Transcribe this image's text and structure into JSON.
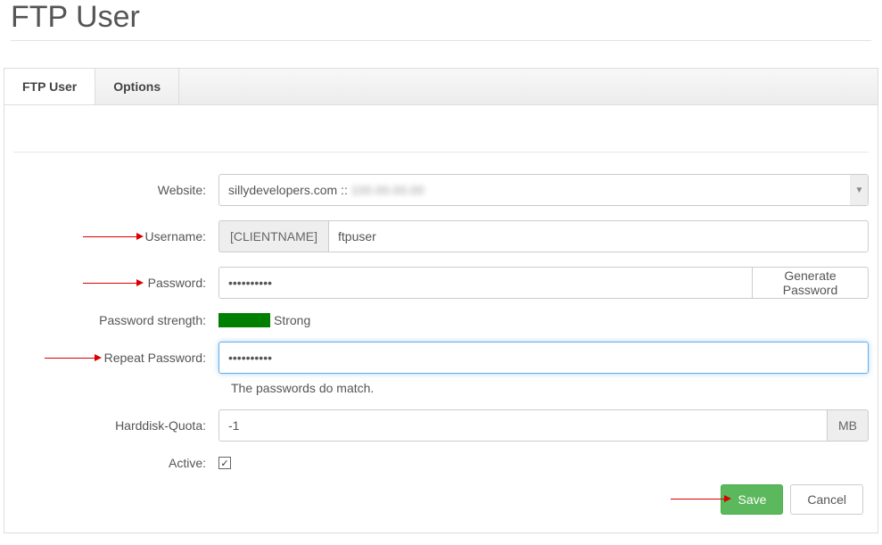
{
  "header": {
    "title": "FTP User"
  },
  "tabs": {
    "active": "FTP User",
    "other": "Options"
  },
  "form": {
    "website": {
      "label": "Website:",
      "value": "sillydevelopers.com ::",
      "blurred_suffix": "100.00.00.00"
    },
    "username": {
      "label": "Username:",
      "prefix": "[CLIENTNAME]",
      "value": "ftpuser"
    },
    "password": {
      "label": "Password:",
      "value": "••••••••••",
      "generate": "Generate Password"
    },
    "strength": {
      "label": "Password strength:",
      "text": "Strong"
    },
    "repeat": {
      "label": "Repeat Password:",
      "value": "••••••••••",
      "match_text": "The passwords do match."
    },
    "quota": {
      "label": "Harddisk-Quota:",
      "value": "-1",
      "unit": "MB"
    },
    "active": {
      "label": "Active:",
      "checked": true
    }
  },
  "buttons": {
    "save": "Save",
    "cancel": "Cancel"
  }
}
